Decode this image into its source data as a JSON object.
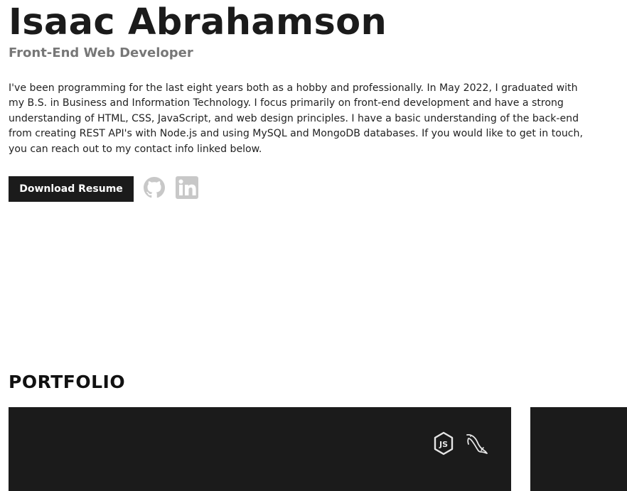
{
  "header": {
    "name": "Isaac Abrahamson",
    "role": "Front-End Web Developer"
  },
  "bio": "I've been programming for the last eight years both as a hobby and professionally. In May 2022, I graduated with my B.S. in Business and Information Technology. I focus primarily on front-end development and have a strong understanding of HTML, CSS, JavaScript, and web design principles. I have a basic understanding of the back-end from creating REST API's with Node.js and using MySQL and MongoDB databases. If you would like to get in touch, you can reach out to my contact info linked below.",
  "actions": {
    "resume_label": "Download Resume",
    "social_icons": [
      "github-icon",
      "linkedin-icon"
    ],
    "social_color": "#c8c8c8",
    "button_color": "#1b1b1b"
  },
  "portfolio": {
    "title": "PORTFOLIO",
    "cards": [
      {
        "tech_icons": [
          "nodejs-icon",
          "mysql-dolphin-icon"
        ]
      },
      {
        "tech_icons": []
      }
    ],
    "card_color": "#1b1b1b",
    "icon_color": "#e6e6e6"
  }
}
